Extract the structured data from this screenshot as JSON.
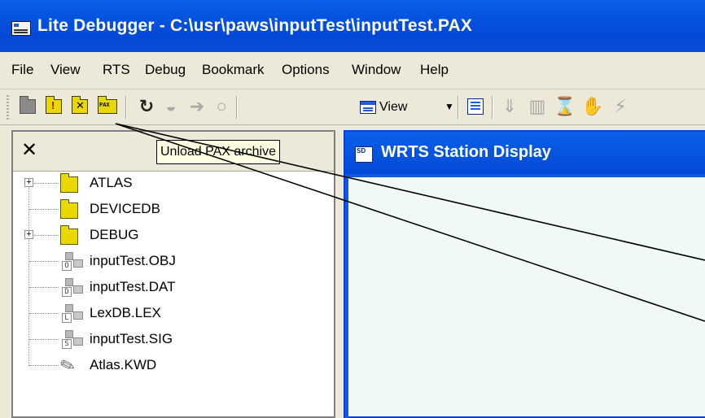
{
  "window": {
    "title": "Lite Debugger - C:\\usr\\paws\\inputTest\\inputTest.PAX"
  },
  "menu": [
    "File",
    "View",
    "RTS",
    "Debug",
    "Bookmark",
    "Options",
    "Window",
    "Help"
  ],
  "toolbar": {
    "view_label": "View",
    "pax_label": "PAX"
  },
  "left_pane": {
    "close_label": "✕",
    "tooltip": "Unload PAX archive",
    "tree": [
      {
        "label": "ATLAS",
        "expandable": true,
        "expander": "+",
        "icon": "folder-icon"
      },
      {
        "label": "DEVICEDB",
        "expandable": false,
        "icon": "folder-icon"
      },
      {
        "label": "DEBUG",
        "expandable": true,
        "expander": "+",
        "icon": "folder-icon"
      },
      {
        "label": "inputTest.OBJ",
        "expandable": false,
        "icon": "object-file-icon",
        "glyph": "O"
      },
      {
        "label": "inputTest.DAT",
        "expandable": false,
        "icon": "data-file-icon",
        "glyph": "D"
      },
      {
        "label": "LexDB.LEX",
        "expandable": false,
        "icon": "lexicon-file-icon",
        "glyph": "L"
      },
      {
        "label": "inputTest.SIG",
        "expandable": false,
        "icon": "signal-file-icon",
        "glyph": "S"
      },
      {
        "label": "Atlas.KWD",
        "expandable": false,
        "icon": "brush-icon"
      }
    ]
  },
  "right_window": {
    "title": "WRTS Station Display"
  }
}
